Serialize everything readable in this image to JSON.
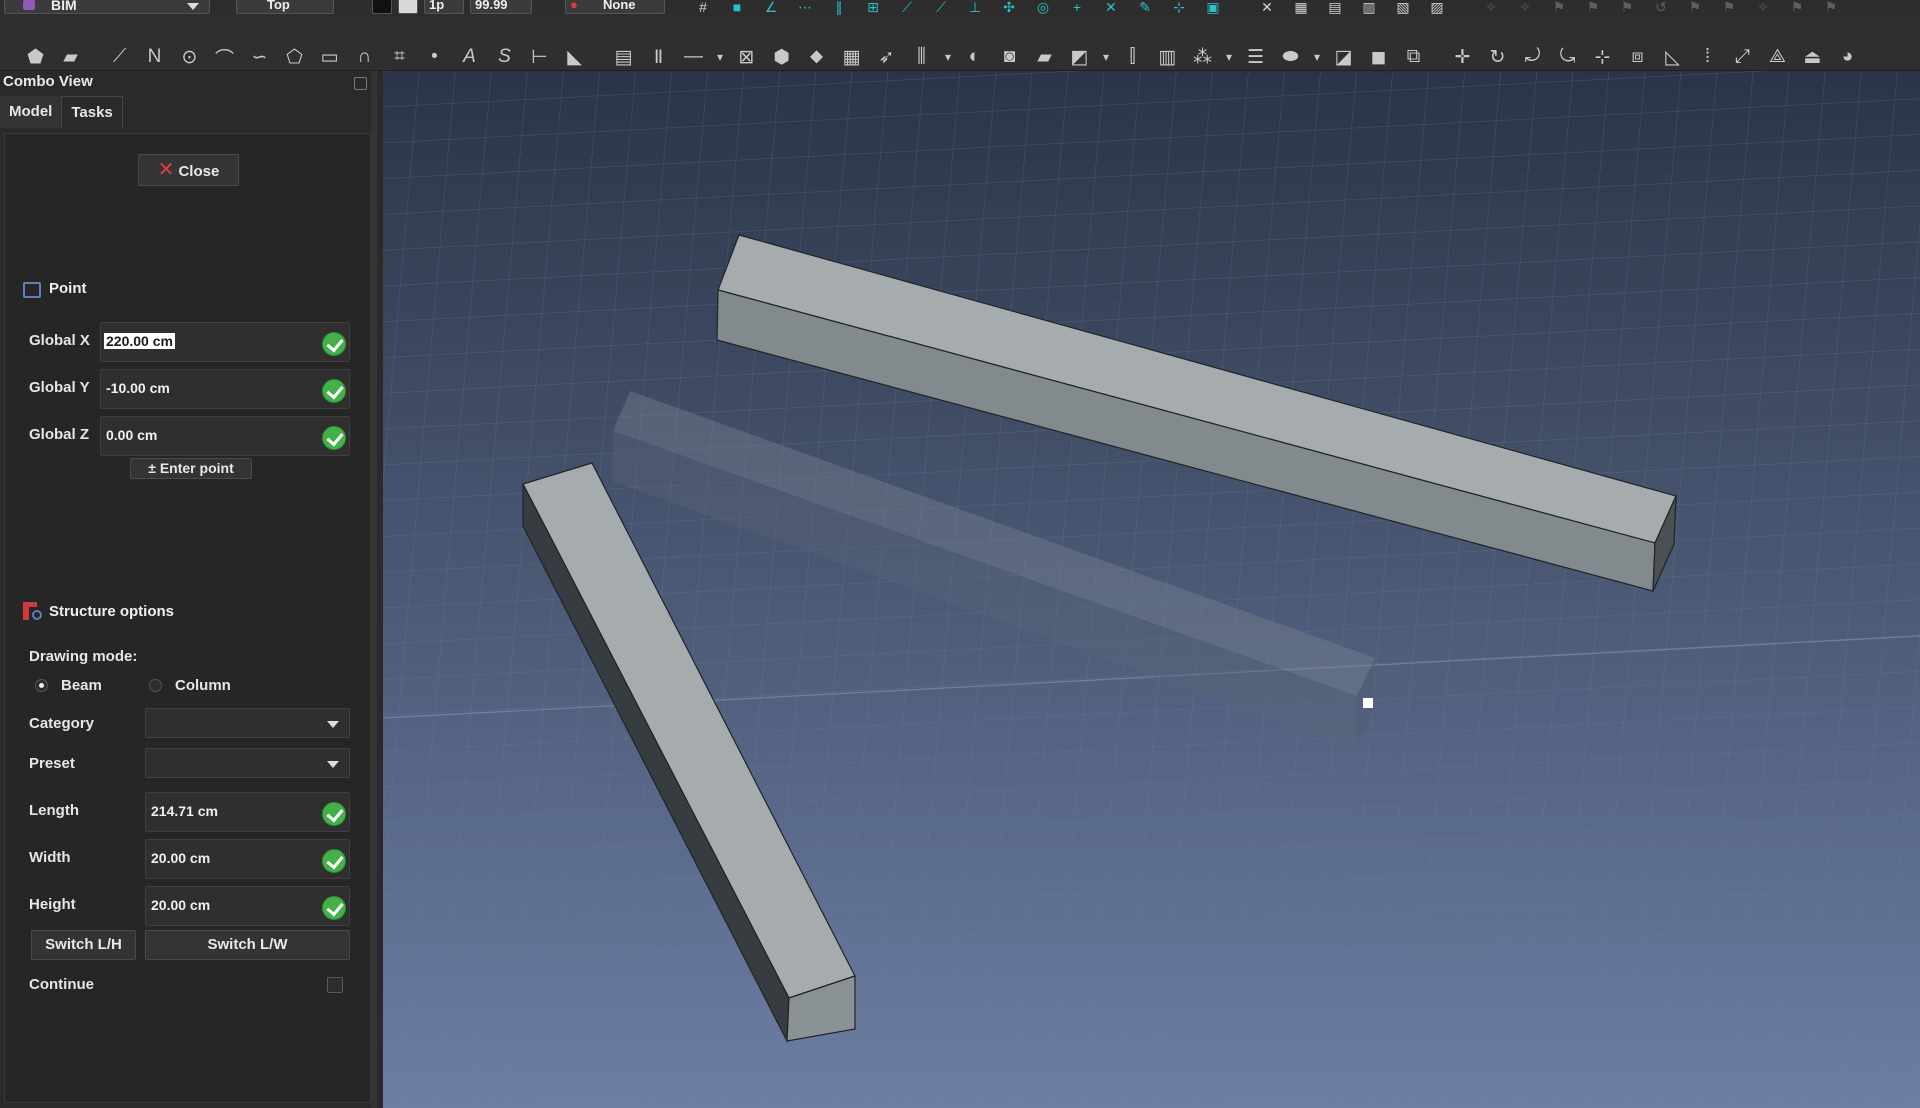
{
  "toolbar1": {
    "workbench": "BIM",
    "view": "Top",
    "linewidth": "1p",
    "fontsize": "99.99",
    "group": "None"
  },
  "panel": {
    "title": "Combo View",
    "tabs": [
      "Model",
      "Tasks"
    ],
    "close_label": "Close",
    "point": {
      "heading": "Point",
      "labels": {
        "x": "Global X",
        "y": "Global Y",
        "z": "Global Z"
      },
      "x": "220.00 cm",
      "y": "-10.00 cm",
      "z": "0.00 cm",
      "enter_point": "Enter point"
    },
    "structure": {
      "heading": "Structure options",
      "drawing_mode_label": "Drawing mode:",
      "mode_beam": "Beam",
      "mode_column": "Column",
      "selected_mode": "Beam",
      "category_label": "Category",
      "category_value": "",
      "preset_label": "Preset",
      "preset_value": "",
      "length_label": "Length",
      "length": "214.71 cm",
      "width_label": "Width",
      "width": "20.00 cm",
      "height_label": "Height",
      "height": "20.00 cm",
      "switch_lh": "Switch L/H",
      "switch_lw": "Switch L/W",
      "continue_label": "Continue",
      "continue_checked": false
    }
  },
  "colors": {
    "accent_icon": "#27c1c9",
    "ok_green": "#44b048",
    "close_red": "#e23b3b",
    "viewport_top": "#2b3447",
    "viewport_bottom": "#6c7ea4",
    "beam_face": "#a6acae"
  },
  "icons": {
    "toolbar2": [
      "part-icon",
      "folder-icon",
      "line-icon",
      "wire-icon",
      "circle-icon",
      "arc-icon",
      "arc-3pt-icon",
      "polygon-icon",
      "rectangle-icon",
      "bezier-icon",
      "bspline-icon",
      "point-icon",
      "text-icon",
      "shapestring-icon",
      "dimension-icon",
      "label-icon",
      "wall-icon",
      "structure-icon",
      "line-tool-icon",
      "window-icon",
      "roof-icon",
      "floor-icon",
      "space-icon",
      "stairs-icon",
      "rebar-icon",
      "equipment-icon",
      "pipe-icon",
      "schedule-icon",
      "section-icon",
      "material-icon",
      "move-icon",
      "rotate-icon",
      "offset-icon",
      "trim-icon",
      "scale-icon",
      "mirror-icon",
      "array-icon"
    ]
  }
}
